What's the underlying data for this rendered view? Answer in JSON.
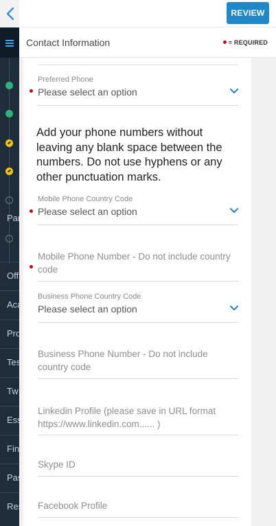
{
  "topbar": {
    "review_label": "REVIEW"
  },
  "header": {
    "title": "Contact Information",
    "required_legend": "= REQUIRED"
  },
  "sidebar": {
    "items": [
      "Par",
      "Off",
      "Aca",
      "Pro",
      "Tes",
      "Tw",
      "Ess",
      "Fin",
      "Pas",
      "Res"
    ]
  },
  "form": {
    "preferred_phone": {
      "label": "Preferred Phone",
      "value": "Please select an option"
    },
    "instruction": "Add your phone numbers without leaving any blank space between the numbers. Do not use hyphens or any other punctuation marks.",
    "mobile_country_code": {
      "label": "Mobile Phone Country Code",
      "value": "Please select an option"
    },
    "mobile_number": {
      "placeholder": "Mobile Phone Number - Do not include country code"
    },
    "business_country_code": {
      "label": "Business Phone Country Code",
      "value": "Please select an option"
    },
    "business_number": {
      "placeholder": "Business Phone Number - Do not include country code"
    },
    "linkedin": {
      "placeholder": "Linkedin Profile (please save in URL format https://www.linkedin.com...... )"
    },
    "skype": {
      "placeholder": "Skype ID"
    },
    "facebook": {
      "placeholder": "Facebook Profile"
    }
  },
  "colors": {
    "accent": "#1e88c8",
    "required": "#d0021b",
    "sidebar": "#1f2d3a",
    "step_complete": "#2fb37a",
    "step_in_progress": "#f0c419"
  }
}
